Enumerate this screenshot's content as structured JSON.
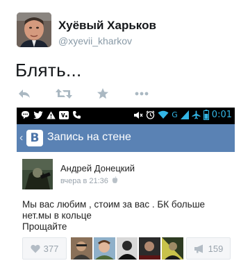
{
  "tweet": {
    "author_name": "Хуёвый Харьков",
    "author_handle": "@xyevii_kharkov",
    "text": "Блять...",
    "actions": [
      {
        "name": "reply",
        "icon": "reply-icon"
      },
      {
        "name": "retweet",
        "icon": "retweet-icon"
      },
      {
        "name": "favorite",
        "icon": "star-icon"
      },
      {
        "name": "more",
        "icon": "more-icon"
      }
    ]
  },
  "screenshot": {
    "statusbar": {
      "left_icons": [
        "chat-icon",
        "twitter-icon",
        "warning-icon",
        "vk-icon",
        "phone-icon"
      ],
      "right_icons": [
        "mute-icon",
        "alarm-icon",
        "wifi-icon",
        "signal-icon",
        "airplane-icon",
        "battery-icon"
      ],
      "network": "G",
      "time": "0:01",
      "accent": "#33b5e5"
    },
    "appbar": {
      "logo_letter": "В",
      "title": "Запись на стене",
      "color": "#5a82b4"
    },
    "post": {
      "author": "Андрей Донецкий",
      "time": "вчера в 21:36",
      "text_lines": [
        "Мы вас любим , стоим за вас . БК больше",
        "нет.мы в кольце",
        "Прощайте"
      ],
      "likes": "377",
      "reposts": "159",
      "liker_count": 5
    }
  }
}
